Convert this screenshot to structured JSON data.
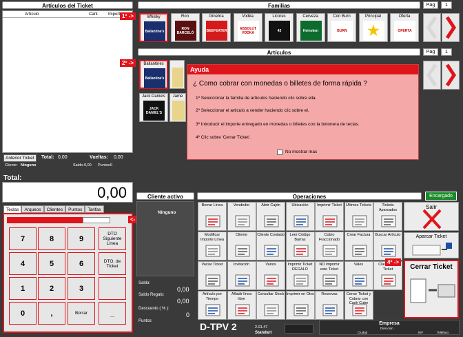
{
  "ticket": {
    "title": "Artículos del Ticket",
    "columns": [
      "Artículo",
      "Cant",
      "Importe"
    ],
    "prev_button": "Anterior Ticket",
    "total_label": "Total:",
    "total_value": "0,00",
    "change_label": "Vueltas:",
    "change_value": "0,00",
    "client_label": "Cliente:",
    "client_value": "Ninguno",
    "balance_label": "Saldo:",
    "balance_value": "0,00",
    "points_label": "Puntos:",
    "points_value": "0"
  },
  "total": {
    "label": "Total:",
    "value": "0,00"
  },
  "tabs": [
    "Teclas",
    "Arqueos",
    "Clientes",
    "Puntos",
    "Tarifas"
  ],
  "keypad": {
    "keys": [
      "7",
      "8",
      "9",
      "4",
      "5",
      "6",
      "1",
      "2",
      "3",
      "0",
      ",",
      "Borrar"
    ],
    "side_keys": [
      "DTO Siguiente Línea",
      "DTO. de Ticket",
      "",
      "_"
    ]
  },
  "families": {
    "title": "Familias",
    "page_label": "Pag",
    "page_value": "1",
    "items": [
      {
        "label": "Whisky",
        "img": "Ballantine's",
        "color": "#1b2f6e"
      },
      {
        "label": "Ron",
        "img": "RON BARCELÓ",
        "color": "#5a1010"
      },
      {
        "label": "Ginebra",
        "img": "BEEFEATER",
        "color": "#d41a1a"
      },
      {
        "label": "Vodka",
        "img": "ABSOLUT VODKA",
        "color": "#ffffff"
      },
      {
        "label": "Licores",
        "img": "43",
        "color": "#111111"
      },
      {
        "label": "Cerveza",
        "img": "Heineken",
        "color": "#0d6b2e"
      },
      {
        "label": "Con Burn",
        "img": "BURN",
        "color": "#ffffff"
      },
      {
        "label": "Principal",
        "img": "★",
        "color": "#ffffff"
      },
      {
        "label": "Oferta",
        "img": "OFERTA",
        "color": "#ffffff"
      }
    ]
  },
  "articles": {
    "title": "Artículos",
    "page_label": "Pag",
    "page_value": "1",
    "items": [
      {
        "label": "Ballantines",
        "img": "Ballantine's",
        "color": "#1b2f6e"
      },
      {
        "label": "Jack Daniels",
        "img": "JACK DANIEL'S",
        "color": "#111111"
      },
      {
        "label": "Jame",
        "img": "",
        "color": "#e8d48a"
      }
    ]
  },
  "markers": {
    "m1": "1º ->",
    "m2": "2º ->",
    "m3": "<- 3º",
    "m4": "4º ->"
  },
  "help": {
    "title": "Ayuda",
    "question": "¿ Como cobrar con monedas o billetes de forma rápida ?",
    "steps": [
      "1º Seleccionar la familia de articulos haciendo clic sobre ella.",
      "2º Seleccionar el articulo a vender haciendo clic sobre el.",
      "3º Introducir el importe entregado en monedas o billetes con la botonera de teclas.",
      "4º Clic sobre 'Cerrar Ticket'."
    ],
    "checkbox_label": "No mostrar mas"
  },
  "client": {
    "title": "Cliente activo",
    "name": "Ninguno",
    "saldo_label": "Saldo:",
    "saldo_regalo_label": "Saldo Regalo:",
    "saldo_regalo_value": "0,00",
    "descuento_label": "Descuento ( % ):",
    "descuento_value": "0,00",
    "puntos_label": "Puntos:",
    "puntos_value": "0"
  },
  "operations": {
    "title": "Operaciones",
    "status": "Encargado",
    "row1": [
      "Borrar Línea",
      "Vendedor",
      "Abrir Cajón",
      "Ubicación",
      "Imprimir Ticket",
      "Últimos Tickets",
      "Tickets Aparcados"
    ],
    "row2": [
      "Modificar Importe Línea",
      "Cliente",
      "Cliente Contado",
      "Leer Código Barras",
      "Cobro Fraccionado",
      "Crear Factura",
      "Buscar Artículo"
    ],
    "row3": [
      "Vaciar Ticket",
      "Invitación",
      "Varios",
      "Imprimir Ticket REGALO",
      "NO imprimir este Ticket",
      "Vales",
      "Clientes de Ticket"
    ],
    "row4": [
      "Artículo por Tiempo",
      "Añadir línea libre",
      "Consultar Stock",
      "Imprimir en Otra",
      "Reservas",
      "Cerrar Ticket y Cobrar con Cash Cube"
    ],
    "salir": "Salir",
    "aparcar": "Aparcar Ticket",
    "cerrar": "Cerrar Ticket"
  },
  "footer": {
    "brand": "D-TPV 2",
    "version": "2.01.47",
    "edition": "Standart",
    "company_title": "Empresa",
    "direccion": "Dirección",
    "ciudad": "Ciudad",
    "nif": "NIF",
    "telefono": "Teléfono"
  },
  "colors": {
    "accent": "#e0141b",
    "background": "#3a3a3a",
    "help_bg": "#f5a8a8",
    "encargado": "#1a8a2a"
  }
}
